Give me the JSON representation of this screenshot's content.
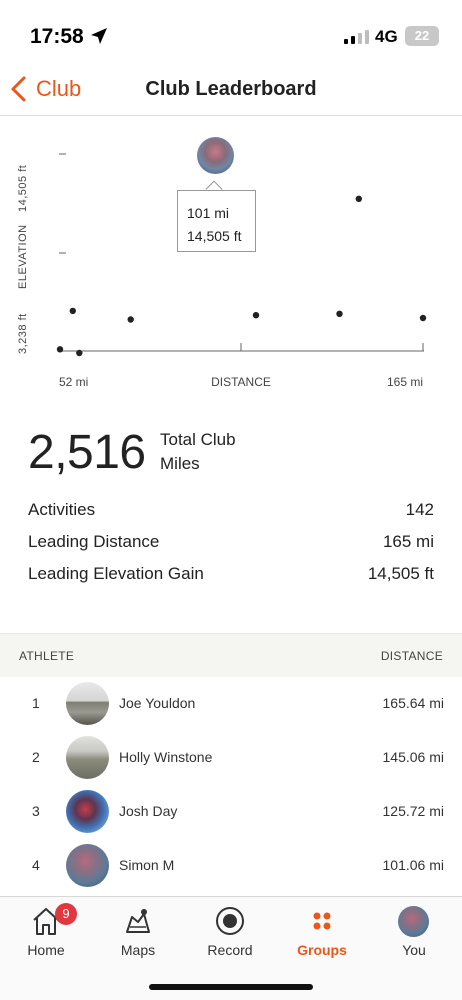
{
  "status_bar": {
    "time": "17:58",
    "network": "4G",
    "battery": "22"
  },
  "nav": {
    "back_label": "Club",
    "title": "Club Leaderboard"
  },
  "chart_data": {
    "type": "scatter",
    "xlabel": "DISTANCE",
    "ylabel": "ELEVATION",
    "x_tick_labels": [
      "52 mi",
      "165 mi"
    ],
    "y_tick_labels": [
      "3,238 ft",
      "14,505 ft"
    ],
    "xlim": [
      52,
      165
    ],
    "ylim": [
      3238,
      14505
    ],
    "points": [
      {
        "x": 52,
        "y": 3500
      },
      {
        "x": 56,
        "y": 6200
      },
      {
        "x": 58,
        "y": 3238
      },
      {
        "x": 74,
        "y": 5600
      },
      {
        "x": 101,
        "y": 14505
      },
      {
        "x": 113,
        "y": 5900
      },
      {
        "x": 139,
        "y": 6000
      },
      {
        "x": 145,
        "y": 14100
      },
      {
        "x": 165,
        "y": 5700
      }
    ],
    "selected": {
      "x": 101,
      "y": 14505
    },
    "tooltip": {
      "distance": "101 mi",
      "elevation": "14,505 ft"
    }
  },
  "summary": {
    "total_value": "2,516",
    "total_label": "Total Club Miles",
    "stats": [
      {
        "label": "Activities",
        "value": "142"
      },
      {
        "label": "Leading Distance",
        "value": "165 mi"
      },
      {
        "label": "Leading Elevation Gain",
        "value": "14,505 ft"
      }
    ]
  },
  "leaderboard": {
    "col_athlete": "ATHLETE",
    "col_distance": "DISTANCE",
    "rows": [
      {
        "rank": "1",
        "name": "Joe Youldon",
        "distance": "165.64 mi"
      },
      {
        "rank": "2",
        "name": "Holly Winstone",
        "distance": "145.06 mi"
      },
      {
        "rank": "3",
        "name": "Josh Day",
        "distance": "125.72 mi"
      },
      {
        "rank": "4",
        "name": "Simon M",
        "distance": "101.06 mi"
      }
    ]
  },
  "tabs": [
    {
      "label": "Home",
      "icon": "home-icon",
      "badge": "9"
    },
    {
      "label": "Maps",
      "icon": "maps-icon"
    },
    {
      "label": "Record",
      "icon": "record-icon"
    },
    {
      "label": "Groups",
      "icon": "groups-icon",
      "active": true
    },
    {
      "label": "You",
      "icon": "avatar"
    }
  ],
  "colors": {
    "accent": "#e8581c",
    "badge": "#e0383e"
  }
}
